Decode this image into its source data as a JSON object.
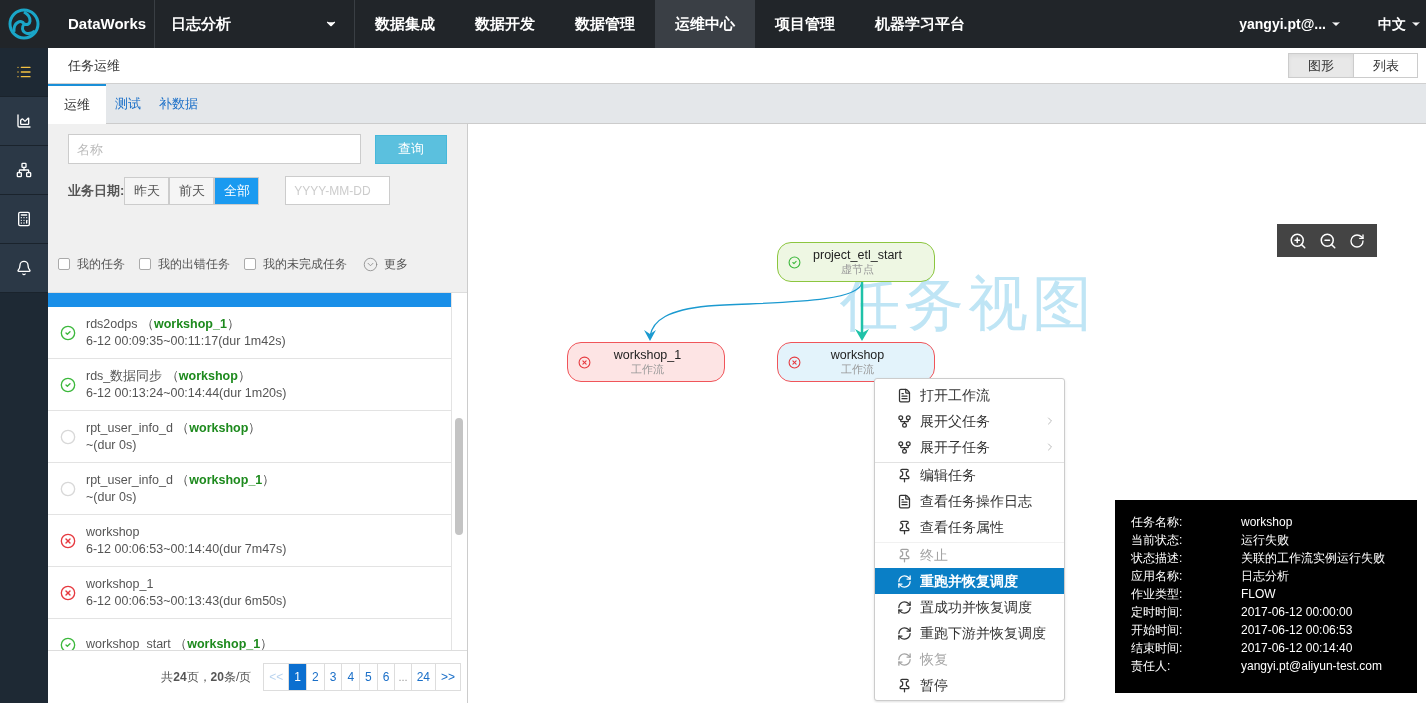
{
  "top_nav": {
    "brand": "DataWorks",
    "project": "日志分析",
    "items": [
      {
        "label": "数据集成",
        "selected": false
      },
      {
        "label": "数据开发",
        "selected": false
      },
      {
        "label": "数据管理",
        "selected": false
      },
      {
        "label": "运维中心",
        "selected": true
      },
      {
        "label": "项目管理",
        "selected": false
      },
      {
        "label": "机器学习平台",
        "selected": false
      }
    ],
    "user": "yangyi.pt@...",
    "language": "中文"
  },
  "side_rail": {
    "items": [
      {
        "kind": "list",
        "selected": true
      },
      {
        "kind": "chart",
        "selected": false
      },
      {
        "kind": "hierarchy",
        "selected": false
      },
      {
        "kind": "calculator",
        "selected": false
      },
      {
        "kind": "bell",
        "selected": false
      }
    ]
  },
  "page_header": {
    "title": "任务运维",
    "view_toggle": [
      {
        "label": "图形",
        "selected": true
      },
      {
        "label": "列表",
        "selected": false
      }
    ]
  },
  "tabs": [
    {
      "label": "运维",
      "selected": true
    },
    {
      "label": "测试",
      "selected": false
    },
    {
      "label": "补数据",
      "selected": false
    }
  ],
  "filters": {
    "name_field": {
      "placeholder": "名称"
    },
    "search_button": "查询",
    "date_label": "业务日期:",
    "date_options": [
      {
        "label": "昨天",
        "selected": false
      },
      {
        "label": "前天",
        "selected": false
      },
      {
        "label": "全部",
        "selected": true
      }
    ],
    "date_field": {
      "placeholder": "YYYY-MM-DD"
    },
    "checkboxes": [
      {
        "label": "我的任务",
        "checked": false
      },
      {
        "label": "我的出错任务",
        "checked": false
      },
      {
        "label": "我的未完成任务",
        "checked": false
      }
    ],
    "more": "更多"
  },
  "task_list": {
    "items": [
      {
        "kind": "success",
        "title": "rds2odps （**workshop_1**）",
        "time": "6-12 00:09:35~00:11:17(dur 1m42s)"
      },
      {
        "kind": "success",
        "title": "rds_数据同步 （**workshop**）",
        "time": "6-12 00:13:24~00:14:44(dur 1m20s)"
      },
      {
        "kind": "pending",
        "title": "rpt_user_info_d （**workshop**）",
        "time": "~(dur 0s)"
      },
      {
        "kind": "pending",
        "title": "rpt_user_info_d （**workshop_1**）",
        "time": "~(dur 0s)"
      },
      {
        "kind": "failed",
        "title": "workshop",
        "time": "6-12 00:06:53~00:14:40(dur 7m47s)"
      },
      {
        "kind": "failed",
        "title": "workshop_1",
        "time": "6-12 00:06:53~00:13:43(dur 6m50s)"
      },
      {
        "kind": "success",
        "title": "workshop_start （**workshop_1**）"
      }
    ]
  },
  "pagination": {
    "summary": "共**24**页，**20**条/页",
    "pages": [
      {
        "kind": "page",
        "label": "<<",
        "selected": false,
        "disabled": true
      },
      {
        "kind": "page",
        "label": "1",
        "selected": true,
        "disabled": false
      },
      {
        "kind": "page",
        "label": "2",
        "selected": false,
        "disabled": false
      },
      {
        "kind": "page",
        "label": "3",
        "selected": false,
        "disabled": false
      },
      {
        "kind": "page",
        "label": "4",
        "selected": false,
        "disabled": false
      },
      {
        "kind": "page",
        "label": "5",
        "selected": false,
        "disabled": false
      },
      {
        "kind": "page",
        "label": "6",
        "selected": false,
        "disabled": false
      },
      {
        "kind": "ellipsis",
        "label": "..."
      },
      {
        "kind": "page",
        "label": "24",
        "selected": false,
        "disabled": false
      },
      {
        "kind": "page",
        "label": ">>",
        "selected": false,
        "disabled": false
      }
    ]
  },
  "canvas": {
    "title": "任务视图",
    "nodes": [
      {
        "name": "project_etl_start",
        "type": "虚节点",
        "kind": "success",
        "selected": false
      },
      {
        "name": "workshop_1",
        "type": "工作流",
        "kind": "failed",
        "selected": false
      },
      {
        "name": "workshop",
        "type": "工作流",
        "kind": "failed",
        "selected": true
      }
    ],
    "context_menu": {
      "items": [
        {
          "kind": "document",
          "label": "打开工作流",
          "disabled": false,
          "highlighted": false,
          "submenu": false,
          "divider_before": false
        },
        {
          "kind": "parent",
          "label": "展开父任务",
          "disabled": false,
          "highlighted": false,
          "submenu": true,
          "divider_before": false
        },
        {
          "kind": "child",
          "label": "展开子任务",
          "disabled": false,
          "highlighted": false,
          "submenu": true,
          "divider_before": false
        },
        {
          "kind": "pin",
          "label": "编辑任务",
          "disabled": false,
          "highlighted": false,
          "submenu": false,
          "divider_before": true
        },
        {
          "kind": "document",
          "label": "查看任务操作日志",
          "disabled": false,
          "highlighted": false,
          "submenu": false,
          "divider_before": false
        },
        {
          "kind": "pin",
          "label": "查看任务属性",
          "disabled": false,
          "highlighted": false,
          "submenu": false,
          "divider_before": false
        },
        {
          "kind": "stop",
          "label": "终止",
          "disabled": true,
          "highlighted": false,
          "submenu": false,
          "divider_before": true
        },
        {
          "kind": "rerun",
          "label": "重跑并恢复调度",
          "disabled": false,
          "highlighted": true,
          "submenu": false,
          "divider_before": false
        },
        {
          "kind": "rerun",
          "label": "置成功并恢复调度",
          "disabled": false,
          "highlighted": false,
          "submenu": false,
          "divider_before": false
        },
        {
          "kind": "rerun",
          "label": "重跑下游并恢复调度",
          "disabled": false,
          "highlighted": false,
          "submenu": false,
          "divider_before": false
        },
        {
          "kind": "rerun",
          "label": "恢复",
          "disabled": true,
          "highlighted": false,
          "submenu": false,
          "divider_before": false
        },
        {
          "kind": "pin",
          "label": "暂停",
          "disabled": false,
          "highlighted": false,
          "submenu": false,
          "divider_before": false
        }
      ]
    },
    "info_panel": {
      "rows": [
        {
          "label": "任务名称:",
          "value": "workshop"
        },
        {
          "label": "当前状态:",
          "value": "运行失败"
        },
        {
          "label": "状态描述:",
          "value": "关联的工作流实例运行失败"
        },
        {
          "label": "应用名称:",
          "value": "日志分析"
        },
        {
          "label": "作业类型:",
          "value": "FLOW"
        },
        {
          "label": "定时时间:",
          "value": "2017-06-12 00:00:00"
        },
        {
          "label": "开始时间:",
          "value": "2017-06-12 00:06:53"
        },
        {
          "label": "结束时间:",
          "value": "2017-06-12 00:14:40"
        },
        {
          "label": "责任人:",
          "value": "yangyi.pt@aliyun-test.com"
        }
      ]
    }
  }
}
